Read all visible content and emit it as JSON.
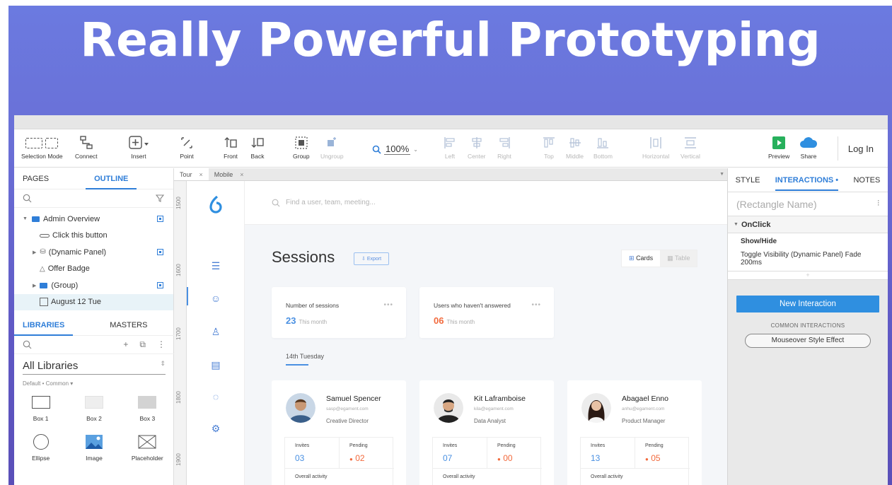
{
  "headline": "Really Powerful Prototyping",
  "toolbar": {
    "selection_mode": "Selection Mode",
    "connect": "Connect",
    "insert": "Insert",
    "point": "Point",
    "front": "Front",
    "back": "Back",
    "group": "Group",
    "ungroup": "Ungroup",
    "zoom": "100%",
    "left": "Left",
    "center": "Center",
    "right": "Right",
    "top": "Top",
    "middle": "Middle",
    "bottom": "Bottom",
    "horizontal": "Horizontal",
    "vertical": "Vertical",
    "preview": "Preview",
    "share": "Share",
    "login": "Log In"
  },
  "left_panel": {
    "tabs": [
      "PAGES",
      "OUTLINE"
    ],
    "outline": [
      {
        "label": "Admin Overview"
      },
      {
        "label": "Click this button"
      },
      {
        "label": "(Dynamic Panel)"
      },
      {
        "label": "Offer Badge"
      },
      {
        "label": "(Group)"
      },
      {
        "label": "August 12 Tue"
      }
    ],
    "lib_tabs": [
      "LIBRARIES",
      "MASTERS"
    ],
    "all_libraries": "All Libraries",
    "subselect": "Default • Common ▾",
    "widgets": [
      "Box 1",
      "Box 2",
      "Box 3",
      "Ellipse",
      "Image",
      "Placeholder"
    ]
  },
  "canvas": {
    "tabs": [
      "Tour",
      "Mobile"
    ],
    "ruler": [
      "1500",
      "1600",
      "1700",
      "1800",
      "1900"
    ],
    "search_placeholder": "Find a user, team, meeting...",
    "title": "Sessions",
    "export": "Export",
    "view_cards": "Cards",
    "view_table": "Table",
    "stats": [
      {
        "title": "Number of sessions",
        "value": "23",
        "sub": "This month",
        "color": "#4a90e2"
      },
      {
        "title": "Users who haven't answered",
        "value": "06",
        "sub": "This month",
        "color": "#f26a3d"
      }
    ],
    "day_label": "14th Tuesday",
    "people": [
      {
        "name": "Samuel Spencer",
        "email": "sasp@egament.com",
        "role": "Creative Director",
        "invites_label": "Invites",
        "invites": "03",
        "pending_label": "Pending",
        "pending": "02",
        "activity": "Overall activity"
      },
      {
        "name": "Kit Laframboise",
        "email": "kila@egament.com",
        "role": "Data Analyst",
        "invites_label": "Invites",
        "invites": "07",
        "pending_label": "Pending",
        "pending": "00",
        "activity": "Overall activity"
      },
      {
        "name": "Abagael Enno",
        "email": "anhu@egament.com",
        "role": "Product Manager",
        "invites_label": "Invites",
        "invites": "13",
        "pending_label": "Pending",
        "pending": "05",
        "activity": "Overall activity"
      }
    ]
  },
  "right_panel": {
    "tabs": [
      "STYLE",
      "INTERACTIONS •",
      "NOTES"
    ],
    "rect_name": "(Rectangle Name)",
    "event": "OnClick",
    "action_title": "Show/Hide",
    "action_desc": "Toggle Visibility (Dynamic Panel) Fade 200ms",
    "new_interaction": "New Interaction",
    "common_label": "COMMON INTERACTIONS",
    "common_item": "Mouseover Style Effect"
  }
}
